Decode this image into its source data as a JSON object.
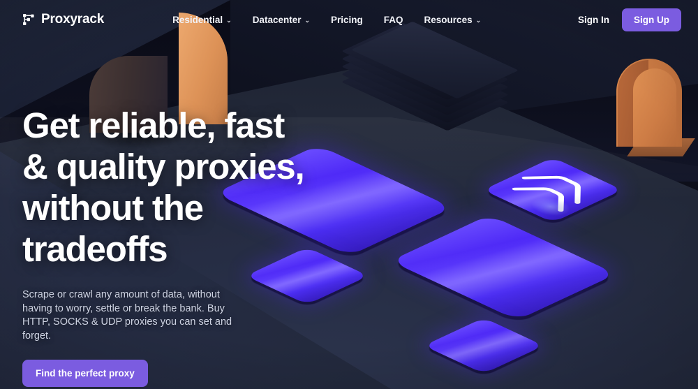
{
  "brand": {
    "name": "Proxyrack",
    "logo_icon": "proxyrack-mark-icon"
  },
  "nav": {
    "items": [
      {
        "label": "Residential",
        "has_dropdown": true,
        "caret": "⌄"
      },
      {
        "label": "Datacenter",
        "has_dropdown": true,
        "caret": "⌄"
      },
      {
        "label": "Pricing",
        "has_dropdown": false,
        "caret": ""
      },
      {
        "label": "FAQ",
        "has_dropdown": false,
        "caret": ""
      },
      {
        "label": "Resources",
        "has_dropdown": true,
        "caret": "⌄"
      }
    ]
  },
  "auth": {
    "sign_in_label": "Sign In",
    "sign_up_label": "Sign Up"
  },
  "hero": {
    "heading_line_1": "Get reliable, fast",
    "heading_line_2": "& quality proxies,",
    "heading_line_3": "without the",
    "heading_line_4": "tradeoffs",
    "paragraph": "Scrape or crawl any amount of data, without having to worry, settle or break the bank. Buy HTTP, SOCKS & UDP proxies you can set and forget.",
    "cta_label": "Find the perfect proxy"
  },
  "illustration": {
    "description": "Isometric 3D scene with glowing purple panels, copper arches and stacked dark slabs",
    "panels": [
      {
        "name": "panel-large",
        "shape": "rectangle"
      },
      {
        "name": "panel-small-left",
        "shape": "square"
      },
      {
        "name": "panel-logo",
        "shape": "square",
        "mark": "chevron-logo-icon"
      },
      {
        "name": "panel-wide",
        "shape": "rectangle"
      },
      {
        "name": "panel-bottom",
        "shape": "square"
      }
    ],
    "arches": [
      {
        "name": "arch-left"
      },
      {
        "name": "arch-right"
      }
    ],
    "slab_stack": {
      "name": "slab-stack",
      "layers": 5
    }
  },
  "colors": {
    "accent_purple": "#7b5ce0",
    "panel_violet": "#4c27f7",
    "copper": "#d9874c",
    "background_dark": "#0b0d18",
    "floor_navy": "#262d44",
    "text_primary": "#ffffff",
    "text_muted": "#ced3e2"
  }
}
